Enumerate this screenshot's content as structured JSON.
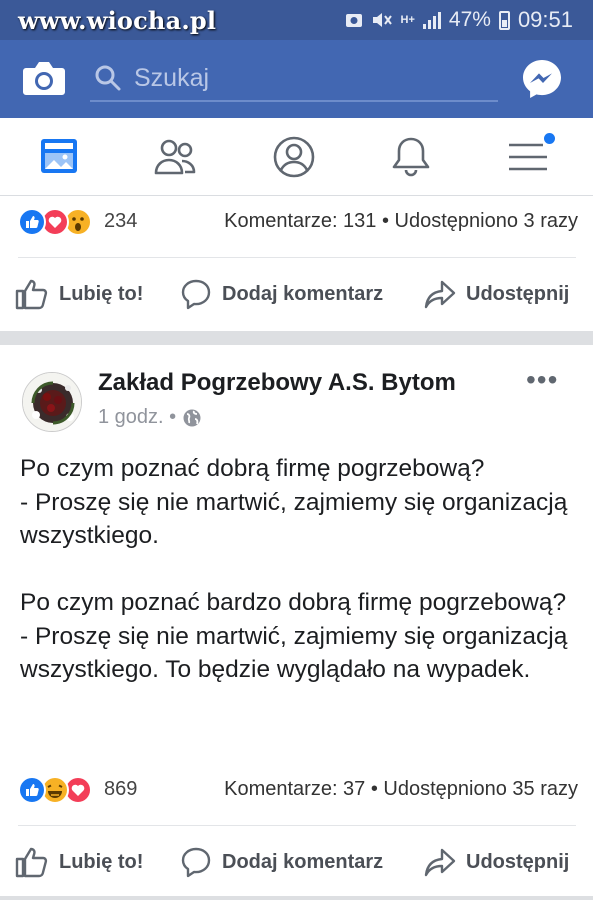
{
  "statusbar": {
    "watermark": "www.wiocha.pl",
    "network": "H+",
    "battery": "47%",
    "time": "09:51"
  },
  "header": {
    "search_placeholder": "Szukaj",
    "icons": [
      "camera-icon",
      "search-icon",
      "messenger-icon"
    ]
  },
  "nav": {
    "items": [
      "news-feed",
      "friends",
      "profile",
      "notifications",
      "menu"
    ],
    "accent": "#1877f2"
  },
  "posts": [
    {
      "reactions": [
        "like",
        "love",
        "wow"
      ],
      "reaction_count": "234",
      "stats": "Komentarze: 131 • Udostępniono 3 razy",
      "actions": {
        "like": "Lubię to!",
        "comment": "Dodaj komentarz",
        "share": "Udostępnij"
      }
    },
    {
      "author": "Zakład Pogrzebowy A.S. Bytom",
      "time": "1 godz. •",
      "text": "Po czym poznać dobrą firmę pogrzebową?\n- Proszę się nie martwić, zajmiemy się organizacją wszystkiego.\n\nPo czym poznać bardzo dobrą firmę pogrzebową?\n- Proszę się nie martwić, zajmiemy się organizacją wszystkiego. To będzie wyglądało na wypadek.",
      "reactions": [
        "like",
        "haha",
        "love"
      ],
      "reaction_count": "869",
      "stats": "Komentarze: 37 • Udostępniono 35 razy",
      "actions": {
        "like": "Lubię to!",
        "comment": "Dodaj komentarz",
        "share": "Udostępnij"
      }
    }
  ],
  "colors": {
    "statusbar": "#3b5998",
    "header": "#4267b2",
    "like": "#1877f2",
    "love": "#f33e58",
    "wow": "#f7b125"
  }
}
